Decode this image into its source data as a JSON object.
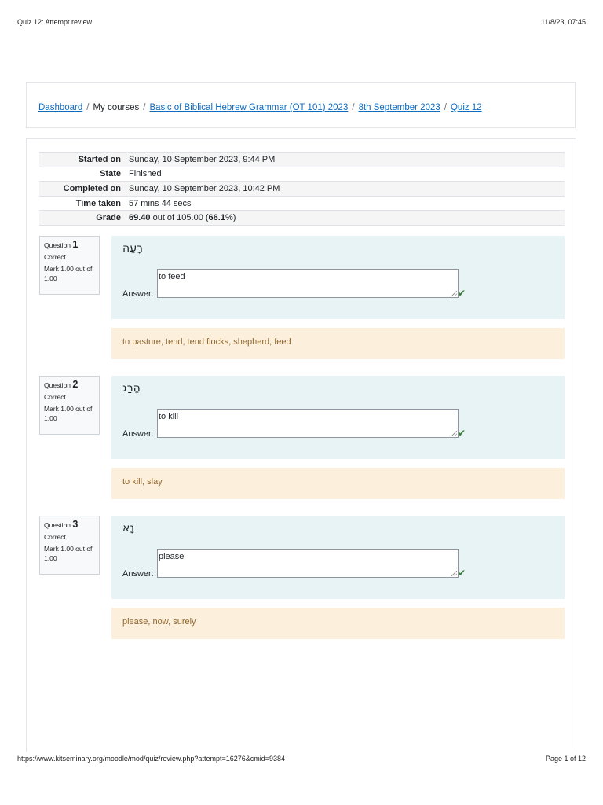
{
  "header": {
    "title": "Quiz 12: Attempt review",
    "datetime": "11/8/23, 07:45"
  },
  "breadcrumb": {
    "items": [
      {
        "label": "Dashboard",
        "link": true
      },
      {
        "label": "My courses",
        "link": false
      },
      {
        "label": "Basic of Biblical Hebrew Grammar (OT 101) 2023",
        "link": true
      },
      {
        "label": "8th September 2023",
        "link": true
      },
      {
        "label": "Quiz 12",
        "link": true
      }
    ],
    "separator": "/"
  },
  "summary": {
    "rows": [
      {
        "label": "Started on",
        "value": "Sunday, 10 September 2023, 9:44 PM"
      },
      {
        "label": "State",
        "value": "Finished"
      },
      {
        "label": "Completed on",
        "value": "Sunday, 10 September 2023, 10:42 PM"
      },
      {
        "label": "Time taken",
        "value": "57 mins 44 secs"
      }
    ],
    "grade": {
      "label": "Grade",
      "score": "69.40",
      "out_of_text": " out of 105.00 (",
      "percent": "66.1",
      "percent_suffix": "%)"
    }
  },
  "questions": [
    {
      "question_label": "Question",
      "number": "1",
      "status": "Correct",
      "mark": "Mark 1.00 out of 1.00",
      "text": "רָעָה",
      "answer_label": "Answer:",
      "answer": "to feed",
      "feedback": "to pasture, tend, tend flocks, shepherd, feed"
    },
    {
      "question_label": "Question",
      "number": "2",
      "status": "Correct",
      "mark": "Mark 1.00 out of 1.00",
      "text": "הָרַג",
      "answer_label": "Answer:",
      "answer": "to kill",
      "feedback": "to kill, slay"
    },
    {
      "question_label": "Question",
      "number": "3",
      "status": "Correct",
      "mark": "Mark 1.00 out of 1.00",
      "text": "נָא",
      "answer_label": "Answer:",
      "answer": "please",
      "feedback": "please, now, surely"
    }
  ],
  "footer": {
    "url": "https://www.kitseminary.org/moodle/mod/quiz/review.php?attempt=16276&cmid=9384",
    "page": "Page 1 of 12"
  },
  "colors": {
    "link": "#0f6cbf",
    "formulation_bg": "#e7f3f5",
    "feedback_bg": "#fcefdc",
    "feedback_text": "#8e662e",
    "correct": "#357a32"
  },
  "icons": {
    "correct": "check-icon"
  }
}
